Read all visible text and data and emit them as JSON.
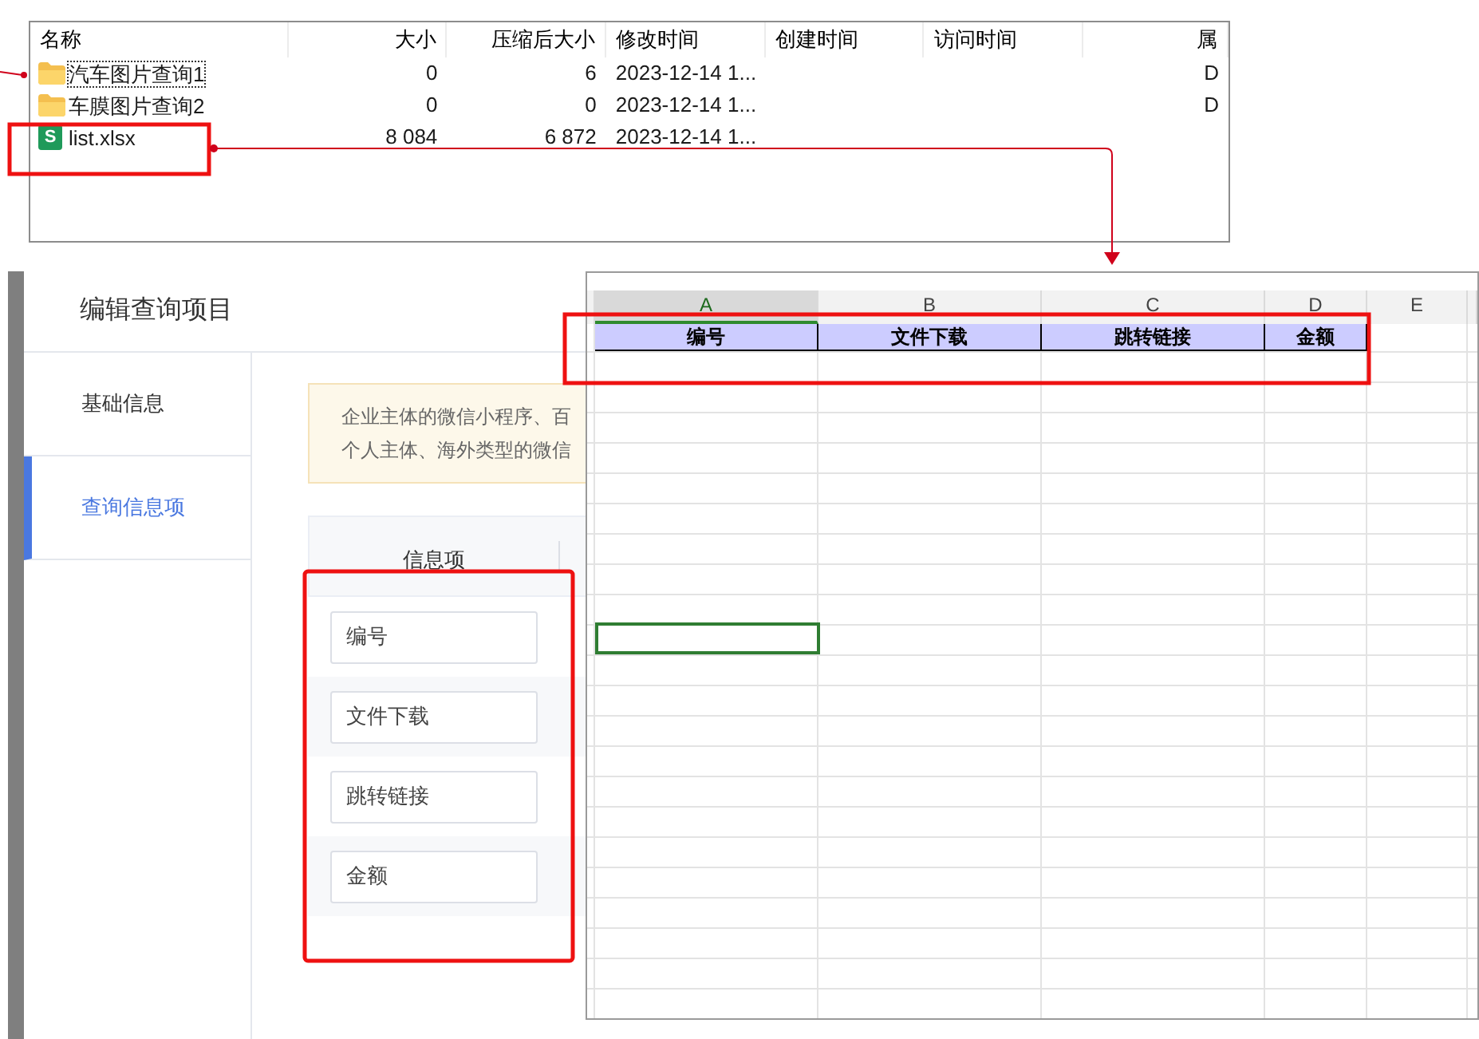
{
  "file_list": {
    "columns": [
      {
        "label": "名称"
      },
      {
        "label": "大小"
      },
      {
        "label": "压缩后大小"
      },
      {
        "label": "修改时间"
      },
      {
        "label": "创建时间"
      },
      {
        "label": "访问时间"
      },
      {
        "label": "属"
      }
    ],
    "rows": [
      {
        "kind": "folder",
        "name": "汽车图片查询1",
        "size": "0",
        "compressed": "6",
        "modified": "2023-12-14 1...",
        "attributes": "D",
        "focused": true
      },
      {
        "kind": "folder",
        "name": "车膜图片查询2",
        "size": "0",
        "compressed": "0",
        "modified": "2023-12-14 1...",
        "attributes": "D",
        "focused": false
      },
      {
        "kind": "sheet",
        "icon_text": "S",
        "name": "list.xlsx",
        "size": "8 084",
        "compressed": "6 872",
        "modified": "2023-12-14 1...",
        "focused": false
      }
    ]
  },
  "query_editor": {
    "title": "编辑查询项目",
    "tabs": [
      {
        "label": "基础信息",
        "selected": false
      },
      {
        "label": "查询信息项",
        "selected": true
      }
    ],
    "notice_lines": [
      "企业主体的微信小程序、百",
      "个人主体、海外类型的微信"
    ],
    "table": {
      "column": "信息项",
      "rows": [
        {
          "value": "编号"
        },
        {
          "value": "文件下载"
        },
        {
          "value": "跳转链接"
        },
        {
          "value": "金额"
        }
      ]
    }
  },
  "spreadsheet": {
    "columns": [
      {
        "label": "A",
        "selected": true
      },
      {
        "label": "B",
        "selected": false
      },
      {
        "label": "C",
        "selected": false
      },
      {
        "label": "D",
        "selected": false
      },
      {
        "label": "E",
        "selected": false
      }
    ],
    "header_row": [
      "编号",
      "文件下载",
      "跳转链接",
      "金额"
    ]
  }
}
